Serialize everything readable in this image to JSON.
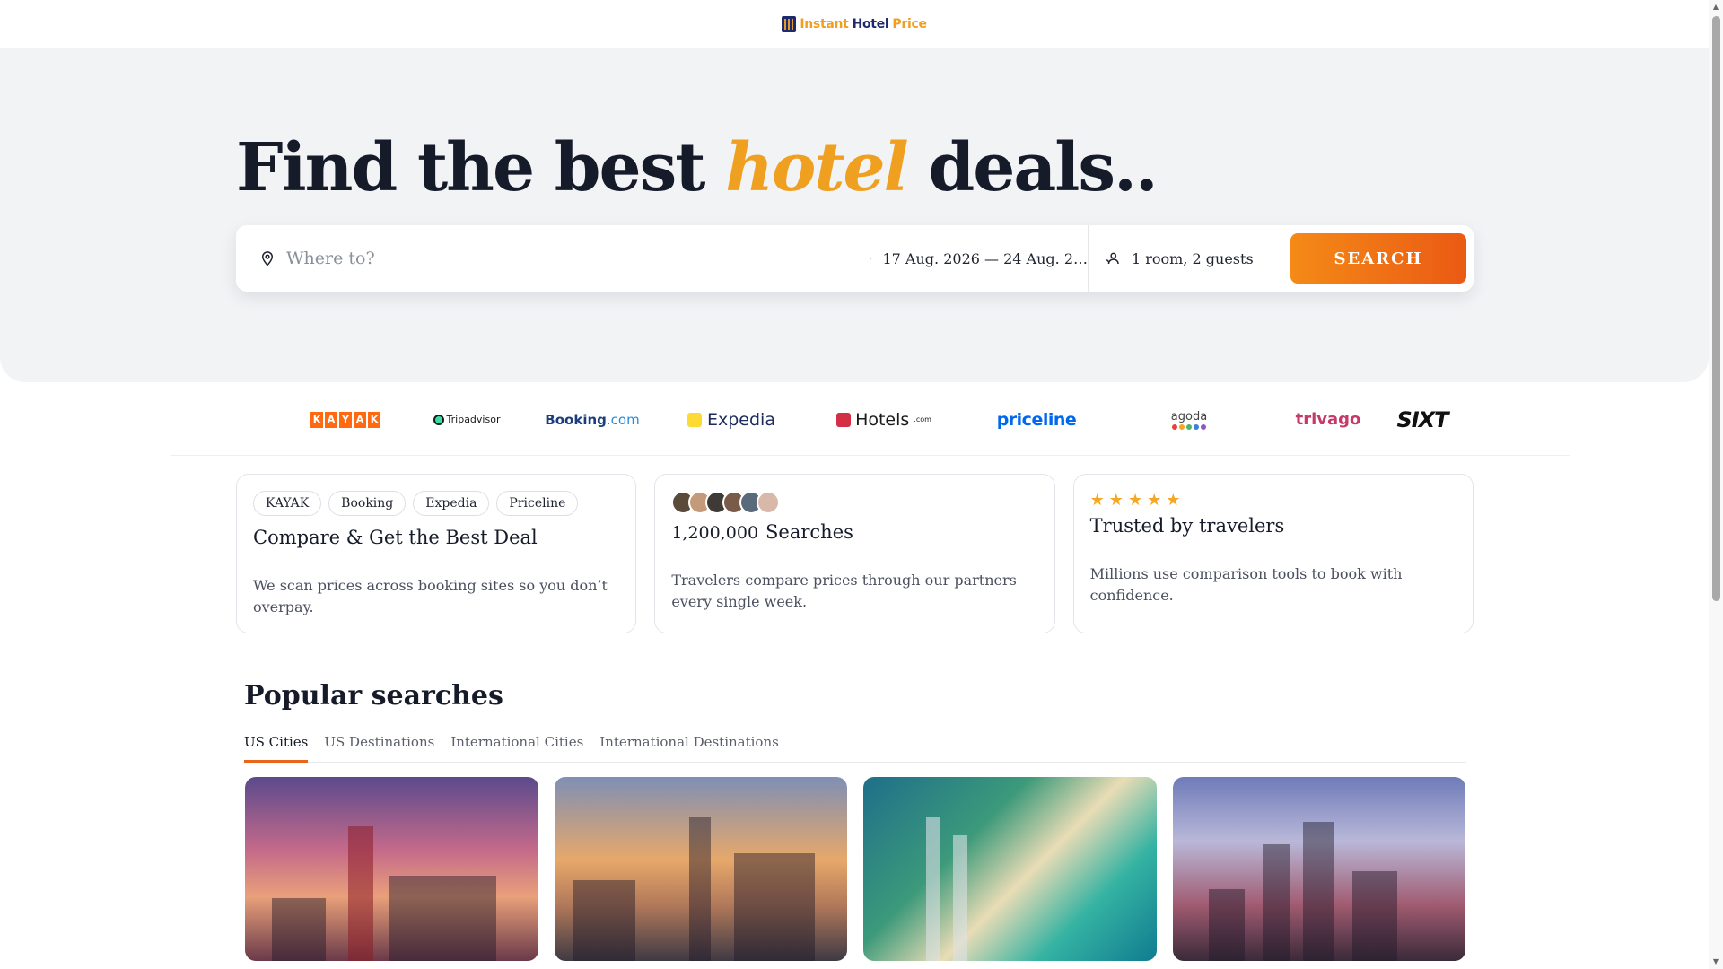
{
  "brand": {
    "name_part1": "Instant",
    "name_part2": "Hotel",
    "name_part3": "Price"
  },
  "hero": {
    "title_before": "Find the best ",
    "title_accent": "hotel",
    "title_after": " deals.."
  },
  "search": {
    "where_placeholder": "Where to?",
    "dates": "17 Aug. 2026 — 24 Aug. 2…",
    "guests": "1 room, 2 guests",
    "button_label": "SEARCH"
  },
  "partners": {
    "kayak": [
      "K",
      "A",
      "Y",
      "A",
      "K"
    ],
    "tripadvisor": "Tripadvisor",
    "booking_name": "Booking",
    "booking_domain": ".com",
    "expedia": "Expedia",
    "hotels_name": "Hotels",
    "hotels_domain": ".com",
    "priceline": "priceline",
    "agoda": "agoda",
    "trivago": "trivago",
    "sixt": "SIXT"
  },
  "features": {
    "compare": {
      "chips": [
        "KAYAK",
        "Booking",
        "Expedia",
        "Priceline"
      ],
      "title": "Compare & Get the Best Deal",
      "text": "We scan prices across booking sites so you don’t overpay."
    },
    "searches": {
      "count": "1,200,000",
      "label": "Searches",
      "text": "Travelers compare prices through our partners every single week."
    },
    "trusted": {
      "stars": 5,
      "title": "Trusted by travelers",
      "text": "Millions use comparison tools to book with confidence."
    }
  },
  "popular": {
    "title": "Popular searches",
    "tabs": [
      "US Cities",
      "US Destinations",
      "International Cities",
      "International Destinations"
    ],
    "active_tab": "US Cities"
  },
  "colors": {
    "accent": "#f0a020",
    "button_start": "#f58a17",
    "button_end": "#ea5a14",
    "tab_underline": "#e8651a"
  }
}
